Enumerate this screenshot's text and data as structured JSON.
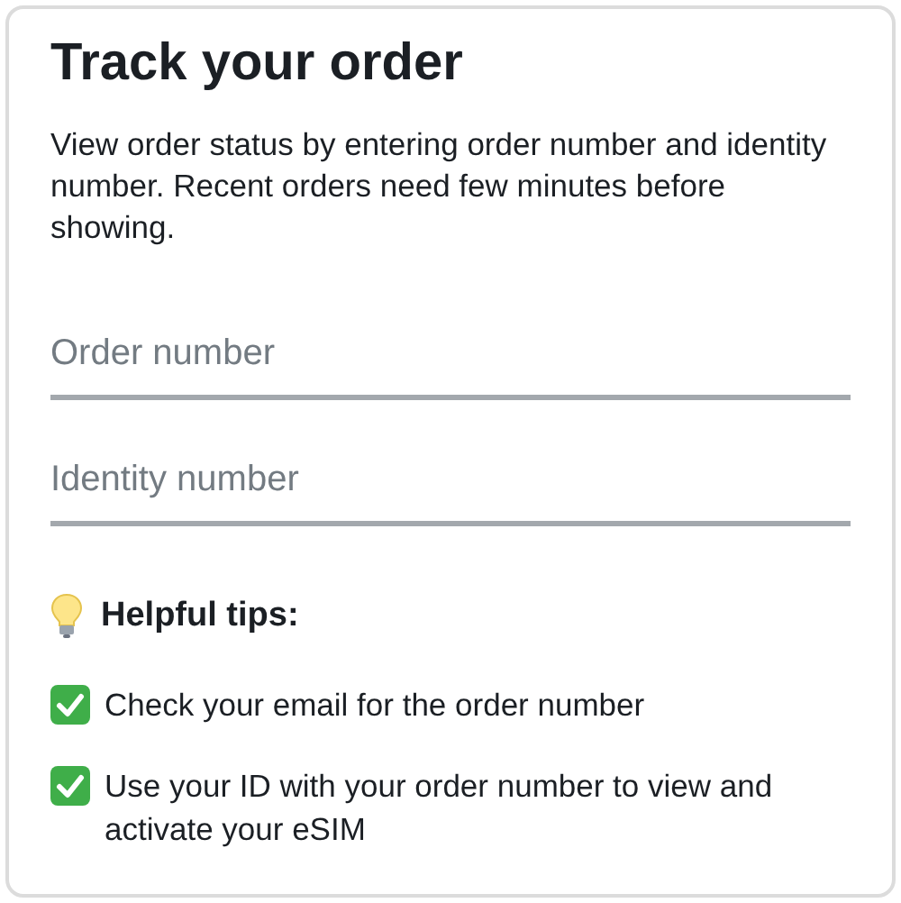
{
  "title": "Track your order",
  "description": "View order status by entering order number and identity number. Recent orders need few minutes before showing.",
  "fields": [
    {
      "placeholder": "Order number"
    },
    {
      "placeholder": "Identity number"
    }
  ],
  "tips": {
    "heading": "Helpful tips:",
    "items": [
      "Check your email for the order number",
      "Use your ID with your order number to view and activate your eSIM"
    ]
  }
}
